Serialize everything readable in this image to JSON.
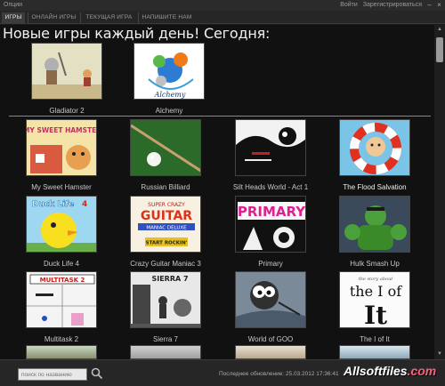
{
  "titlebar": {
    "options_label": "Опции",
    "login_label": "Войти",
    "register_label": "Зарегистрироваться"
  },
  "tabs": [
    {
      "label": "ИГРЫ",
      "active": true
    },
    {
      "label": "ОНЛАЙН ИГРЫ",
      "active": false
    },
    {
      "label": "ТЕКУЩАЯ ИГРА",
      "active": false
    },
    {
      "label": "НАПИШИТЕ НАМ",
      "active": false
    }
  ],
  "heading": "Новые игры каждый день! Сегодня:",
  "featured": [
    {
      "name": "Gladiator 2",
      "icon": "gladiator-thumb"
    },
    {
      "name": "Alchemy",
      "icon": "alchemy-thumb"
    }
  ],
  "games": [
    {
      "name": "My Sweet Hamster",
      "icon": "hamster-thumb"
    },
    {
      "name": "Russian Billiard",
      "icon": "billiard-thumb"
    },
    {
      "name": "Silt Heads World - Act 1",
      "icon": "silt-heads-thumb"
    },
    {
      "name": "The Flood Salvation",
      "icon": "flood-thumb"
    },
    {
      "name": "Duck Life 4",
      "icon": "duck-thumb"
    },
    {
      "name": "Crazy Guitar Maniac 3",
      "icon": "guitar-thumb"
    },
    {
      "name": "Primary",
      "icon": "primary-thumb"
    },
    {
      "name": "Hulk Smash Up",
      "icon": "hulk-thumb"
    },
    {
      "name": "Multitask 2",
      "icon": "multitask-thumb"
    },
    {
      "name": "Sierra 7",
      "icon": "sierra-thumb"
    },
    {
      "name": "World of GOO",
      "icon": "goo-thumb"
    },
    {
      "name": "The I of It",
      "icon": "i-of-it-thumb"
    }
  ],
  "thumb_text": {
    "hamster": "MY SWEET HAMSTER",
    "duck": "Duck Life",
    "duck_num": "4",
    "guitar_1": "SUPER CRAZY",
    "guitar_2": "GUITAR",
    "guitar_3": "MANIAC DELUXE",
    "guitar_4": "START ROCKIN'",
    "primary": "PRIMARY",
    "multitask": "MULTITASK 2",
    "sierra": "SIERRA 7",
    "ioft_small": "the story about",
    "ioft_big": "the I of",
    "ioft_it": "It"
  },
  "footer": {
    "search_placeholder": "поиск по названию",
    "updated": "Последнее обновление: 25.03.2012 17:36:41",
    "watermark_main": "Allsoftfiles",
    "watermark_tld": ".com"
  },
  "colors": {
    "background": "#111111",
    "tab_active": "#3c3c3c",
    "watermark_accent": "#ff5c7a"
  }
}
